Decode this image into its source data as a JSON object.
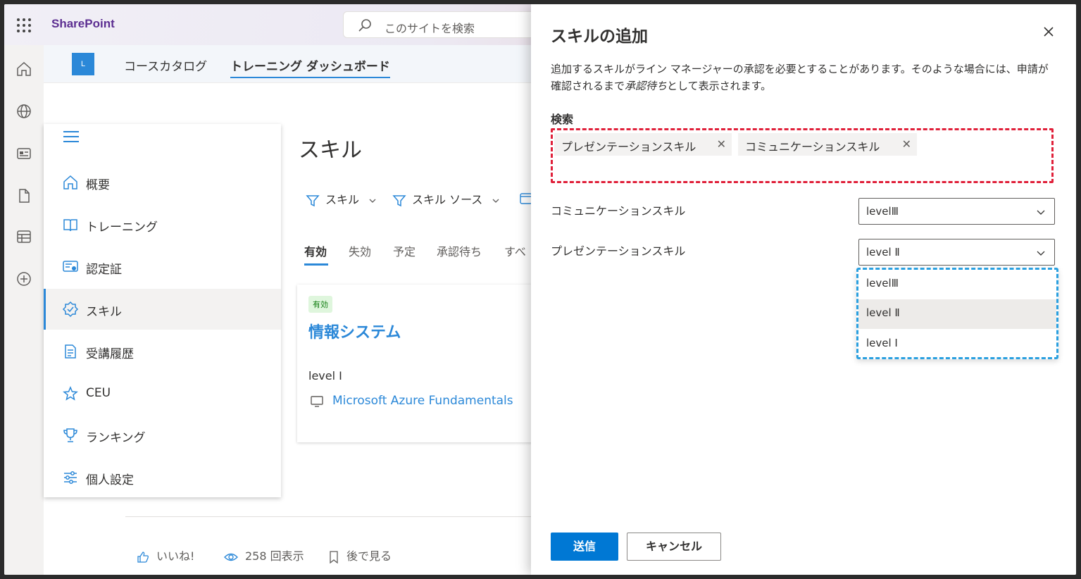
{
  "suitebar": {
    "brand": "SharePoint",
    "search_placeholder": "このサイトを検索"
  },
  "site": {
    "logo_letter": "L",
    "nav": [
      "コースカタログ",
      "トレーニング ダッシュボード"
    ]
  },
  "leftnav": {
    "items": [
      {
        "label": "概要",
        "icon": "home-icon"
      },
      {
        "label": "トレーニング",
        "icon": "book-icon"
      },
      {
        "label": "認定証",
        "icon": "certificate-icon"
      },
      {
        "label": "スキル",
        "icon": "skill-badge-icon",
        "selected": true
      },
      {
        "label": "受講履歴",
        "icon": "history-icon"
      },
      {
        "label": "CEU",
        "icon": "ceu-stars-icon"
      },
      {
        "label": "ランキング",
        "icon": "trophy-icon"
      },
      {
        "label": "個人設定",
        "icon": "settings-sliders-icon"
      }
    ]
  },
  "main": {
    "title": "スキル",
    "filters": [
      "スキル",
      "スキル ソース"
    ],
    "tabs": [
      "有効",
      "失効",
      "予定",
      "承認待ち",
      "すべ"
    ],
    "card": {
      "badge": "有効",
      "title": "情報システム",
      "level": "level Ⅰ",
      "course": "Microsoft Azure Fundamentals"
    },
    "footer": {
      "like": "いいね!",
      "views": "258 回表示",
      "save": "後で見る"
    }
  },
  "panel": {
    "title": "スキルの追加",
    "description_1": "追加するスキルがライン マネージャーの承認を必要とすることがあります。そのような場合には、申請が確認されるまで",
    "description_em": "承認待ち",
    "description_2": "として表示されます。",
    "search_label": "検索",
    "tags": [
      "プレゼンテーションスキル",
      "コミュニケーションスキル"
    ],
    "tag_remove": "✕",
    "rows": [
      {
        "label": "コミュニケーションスキル",
        "value": "levelⅢ"
      },
      {
        "label": "プレゼンテーションスキル",
        "value": "level Ⅱ"
      }
    ],
    "options": [
      {
        "label": "levelⅢ",
        "selected": false
      },
      {
        "label": "level Ⅱ",
        "selected": true
      },
      {
        "label": "level Ⅰ",
        "selected": false
      }
    ],
    "submit": "送信",
    "cancel": "キャンセル"
  },
  "colors": {
    "accent": "#0078d4",
    "link": "#2b88d8",
    "search_highlight": "#e0203a",
    "dropdown_highlight": "#2aa0e0"
  }
}
